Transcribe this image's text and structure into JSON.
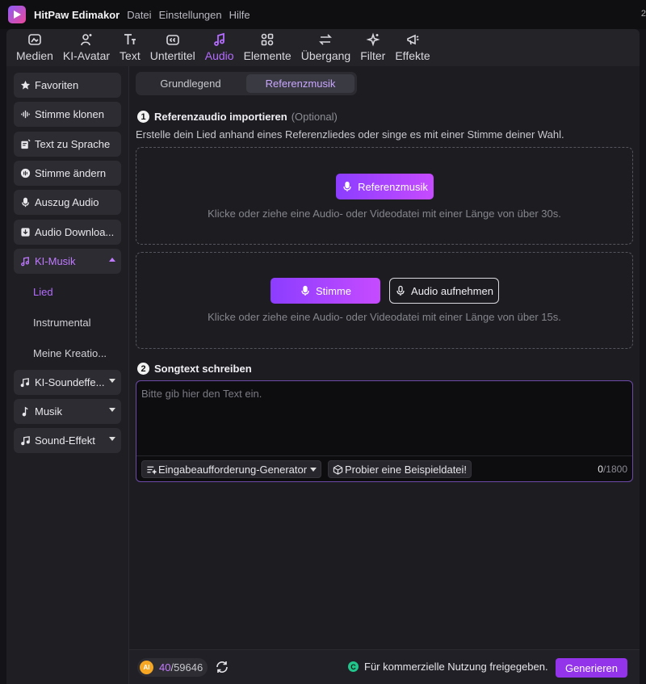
{
  "titlebar": {
    "app_name": "HitPaw Edimakor",
    "menu": [
      "Datei",
      "Einstellungen",
      "Hilfe"
    ],
    "edge_digit": "2"
  },
  "toolbar": {
    "tools": [
      {
        "label": "Medien",
        "icon": "media-icon",
        "active": false
      },
      {
        "label": "KI-Avatar",
        "icon": "avatar-icon",
        "active": false
      },
      {
        "label": "Text",
        "icon": "text-icon",
        "active": false
      },
      {
        "label": "Untertitel",
        "icon": "subtitle-icon",
        "active": false
      },
      {
        "label": "Audio",
        "icon": "audio-icon",
        "active": true
      },
      {
        "label": "Elemente",
        "icon": "elements-icon",
        "active": false
      },
      {
        "label": "Übergang",
        "icon": "transition-icon",
        "active": false
      },
      {
        "label": "Filter",
        "icon": "filter-icon",
        "active": false
      },
      {
        "label": "Effekte",
        "icon": "effects-icon",
        "active": false
      }
    ]
  },
  "sidebar": {
    "items": [
      {
        "label": "Favoriten",
        "icon": "star-icon"
      },
      {
        "label": "Stimme klonen",
        "icon": "waveform-icon"
      },
      {
        "label": "Text zu Sprache",
        "icon": "text-speech-icon"
      },
      {
        "label": "Stimme ändern",
        "icon": "voice-change-icon"
      },
      {
        "label": "Auszug Audio",
        "icon": "microphone-icon"
      },
      {
        "label": "Audio Downloa...",
        "icon": "download-icon"
      },
      {
        "label": "KI-Musik",
        "icon": "ai-music-icon",
        "expanded": true
      },
      {
        "label": "KI-Soundeffe...",
        "icon": "sound-effect-icon"
      },
      {
        "label": "Musik",
        "icon": "music-note-icon"
      },
      {
        "label": "Sound-Effekt",
        "icon": "music-notes-icon"
      }
    ],
    "subitems": [
      {
        "label": "Lied",
        "active": true
      },
      {
        "label": "Instrumental",
        "active": false
      },
      {
        "label": "Meine Kreatio...",
        "active": false
      }
    ]
  },
  "tabs": {
    "items": [
      "Grundlegend",
      "Referenzmusik"
    ],
    "active": "Referenzmusik"
  },
  "section1": {
    "number": "1",
    "title": "Referenzaudio importieren",
    "optional": "(Optional)",
    "description": "Erstelle dein Lied anhand eines Referenzliedes oder singe es mit einer Stimme deiner Wahl.",
    "ref_button": "Referenzmusik",
    "ref_hint": "Klicke oder ziehe eine Audio- oder Videodatei mit einer Länge von über 30s.",
    "voice_button": "Stimme",
    "record_button": "Audio aufnehmen",
    "voice_hint": "Klicke oder ziehe eine Audio- oder Videodatei mit einer Länge von über 15s."
  },
  "section2": {
    "number": "2",
    "title": "Songtext schreiben",
    "placeholder": "Bitte gib hier den Text ein.",
    "prompt_generator": "Eingabeaufforderung-Generator",
    "sample_file": "Probier eine Beispieldatei!",
    "count_current": "0",
    "count_max": "/1800"
  },
  "footer": {
    "ai_badge": "AI",
    "credits_used": "40",
    "credits_total": "/59646",
    "commercial_badge": "C",
    "commercial_text": "Für kommerzielle Nutzung freigegeben.",
    "generate_button": "Generieren"
  },
  "colors": {
    "accent": "#b56cff",
    "generate": "#9333ea",
    "commercial_badge": "#22c58b",
    "credit_coin": "#f5a623"
  }
}
